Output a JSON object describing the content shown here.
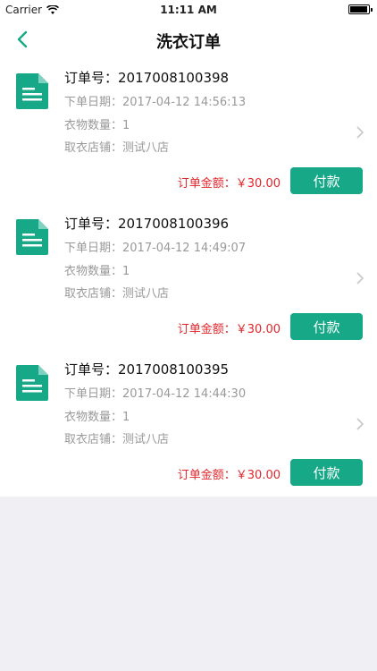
{
  "status_bar": {
    "carrier": "Carrier",
    "time": "11:11 AM"
  },
  "nav": {
    "title": "洗衣订单"
  },
  "colors": {
    "accent": "#17a888",
    "amount": "#e0262b"
  },
  "orders": [
    {
      "order_no_label": "订单号：",
      "order_no": "2017008100398",
      "date_label": "下单日期：",
      "date": "2017-04-12 14:56:13",
      "qty_label": "衣物数量：",
      "qty": "1",
      "store_label": "取衣店铺：",
      "store": "测试八店",
      "amount_label": "订单金额：",
      "amount": "￥30.00",
      "pay_label": "付款"
    },
    {
      "order_no_label": "订单号：",
      "order_no": "2017008100396",
      "date_label": "下单日期：",
      "date": "2017-04-12 14:49:07",
      "qty_label": "衣物数量：",
      "qty": "1",
      "store_label": "取衣店铺：",
      "store": "测试八店",
      "amount_label": "订单金额：",
      "amount": "￥30.00",
      "pay_label": "付款"
    },
    {
      "order_no_label": "订单号：",
      "order_no": "2017008100395",
      "date_label": "下单日期：",
      "date": "2017-04-12 14:44:30",
      "qty_label": "衣物数量：",
      "qty": "1",
      "store_label": "取衣店铺：",
      "store": "测试八店",
      "amount_label": "订单金额：",
      "amount": "￥30.00",
      "pay_label": "付款"
    }
  ]
}
